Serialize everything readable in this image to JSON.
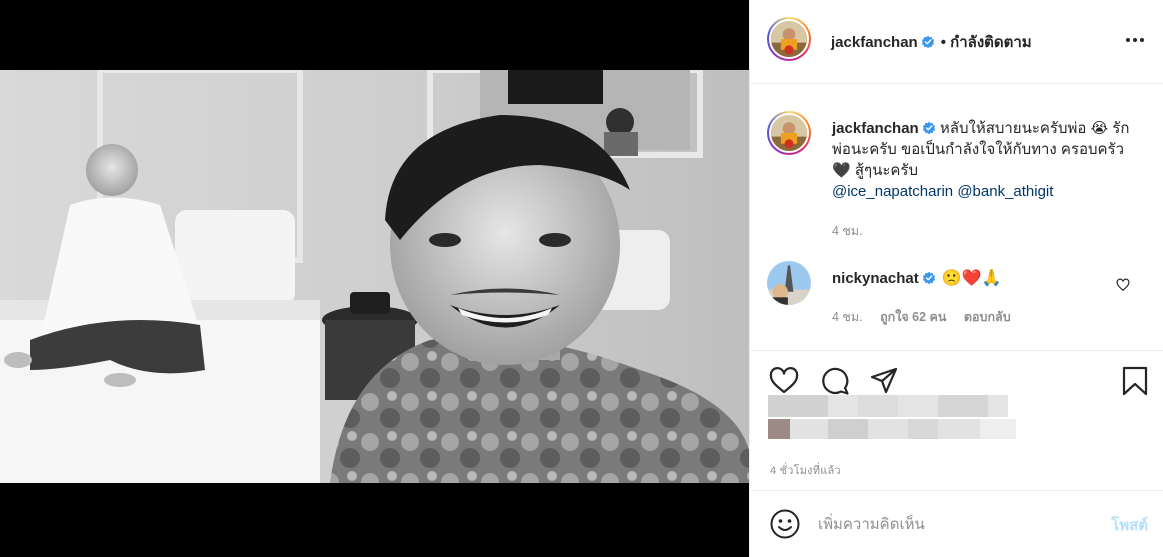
{
  "header": {
    "username": "jackfanchan",
    "follow_status": "• กำลังติดตาม"
  },
  "caption": {
    "username": "jackfanchan",
    "text_part1": "หลับให้สบายนะครับพ่อ",
    "emoji_crying": "😭",
    "text_part2": "รักพ่อนะครับ ขอเป็นกำลังใจให้กับทาง ครอบครัว",
    "emoji_heart_black": "🖤",
    "text_part3": "สู้ๆนะครับ",
    "mention1": "@ice_napatcharin",
    "mention2": "@bank_athigit",
    "time": "4 ชม."
  },
  "comment1": {
    "username": "nickynachat",
    "emojis": "🙁❤️🙏",
    "time": "4 ชม.",
    "likes": "ถูกใจ 62 คน",
    "reply_label": "ตอบกลับ"
  },
  "actions": {
    "post_time": "4 ชั่วโมงที่แล้ว"
  },
  "add_comment": {
    "placeholder": "เพิ่มความคิดเห็น",
    "post_label": "โพสต์"
  },
  "colors": {
    "verified": "#3897f0",
    "link": "#00376b",
    "post_button_disabled": "#b2dffc",
    "secondary_text": "#8e8e8e"
  },
  "icons": [
    "more-icon",
    "verified-icon",
    "heart-icon",
    "comment-icon",
    "share-icon",
    "bookmark-icon",
    "emoji-icon"
  ]
}
